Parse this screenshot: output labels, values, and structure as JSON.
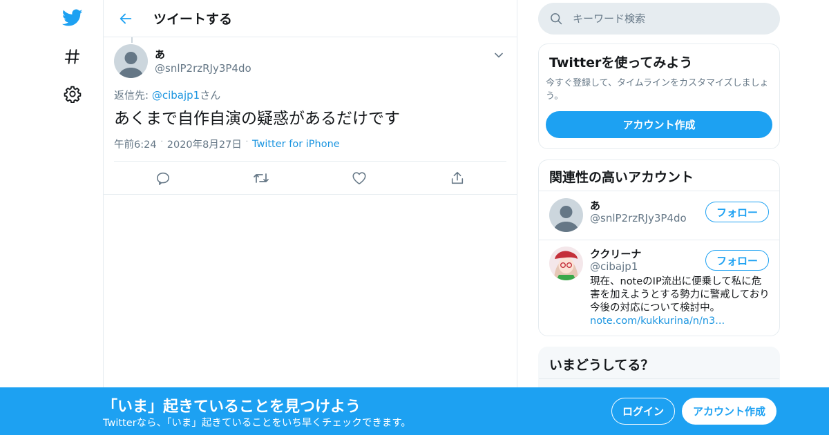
{
  "colors": {
    "accent": "#1da1f2",
    "link": "#1b95e0",
    "muted": "#657786",
    "border": "#e6ecf0"
  },
  "nav": {
    "items": [
      {
        "icon": "twitter-bird-icon"
      },
      {
        "icon": "hashtag-icon"
      },
      {
        "icon": "gear-icon"
      }
    ]
  },
  "header": {
    "title": "ツイートする"
  },
  "tweet": {
    "author_name": "あ",
    "author_handle": "@snlP2rzRJy3P4do",
    "reply_prefix": "返信先: ",
    "reply_handle": "@cibajp1",
    "reply_suffix": "さん",
    "text": "あくまで自作自演の疑惑があるだけです",
    "time": "午前6:24",
    "date": "2020年8月27日",
    "source": "Twitter for iPhone",
    "dot": "·"
  },
  "search": {
    "placeholder": "キーワード検索"
  },
  "signup_card": {
    "title": "Twitterを使ってみよう",
    "description": "今すぐ登録して、タイムラインをカスタマイズしましょう。",
    "button": "アカウント作成"
  },
  "related": {
    "title": "関連性の高いアカウント",
    "accounts": [
      {
        "name": "あ",
        "handle": "@snlP2rzRJy3P4do",
        "follow": "フォロー"
      },
      {
        "name": "ククリーナ",
        "handle": "@cibajp1",
        "follow": "フォロー",
        "bio": "現在、noteのIP流出に便乗して私に危害を加えようとする勢力に警戒しており今後の対応について検討中。",
        "link": "note.com/kukkurina/n/n3..."
      }
    ]
  },
  "trends": {
    "title": "いまどうしてる？"
  },
  "bottom_bar": {
    "title": "「いま」起きていることを見つけよう",
    "subtitle": "Twitterなら、「いま」起きていることをいち早くチェックできます。",
    "login": "ログイン",
    "signup": "アカウント作成"
  }
}
